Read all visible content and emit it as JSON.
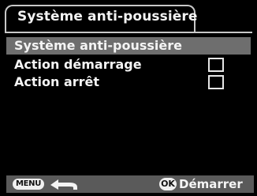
{
  "header": {
    "title": "Système anti-poussière"
  },
  "menu": {
    "items": [
      {
        "label": "Système anti-poussière",
        "selected": true,
        "has_checkbox": false
      },
      {
        "label": "Action démarrage",
        "selected": false,
        "has_checkbox": true,
        "checked": false
      },
      {
        "label": "Action arrêt",
        "selected": false,
        "has_checkbox": true,
        "checked": false
      }
    ]
  },
  "footer": {
    "menu_button": "MENU",
    "back_icon": "return-arrow-icon",
    "ok_button": "OK",
    "start_label": "Démarrer"
  },
  "colors": {
    "background": "#000000",
    "highlight": "#6e6e6e",
    "footer_bar": "#5a5a5a",
    "text": "#f4f4f4",
    "frame": "#c8c8c8"
  }
}
